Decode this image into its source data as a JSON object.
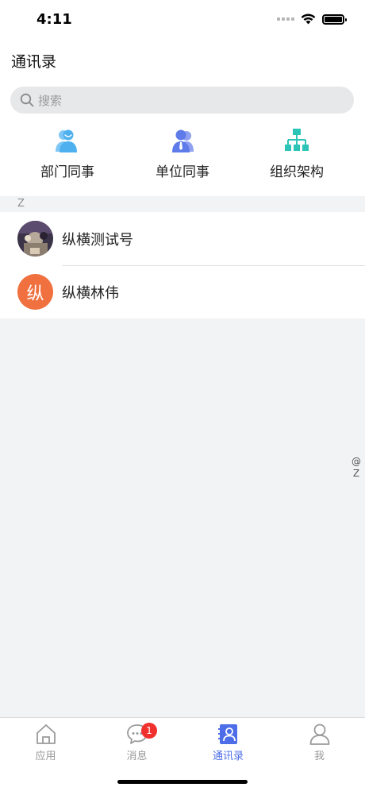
{
  "status_bar": {
    "time": "4:11"
  },
  "header": {
    "title": "通讯录"
  },
  "search": {
    "placeholder": "搜索"
  },
  "quick_actions": [
    {
      "label": "部门同事",
      "icon": "department-colleagues-icon",
      "color": "#4fb0ef"
    },
    {
      "label": "单位同事",
      "icon": "unit-colleagues-icon",
      "color": "#5f7be9"
    },
    {
      "label": "组织架构",
      "icon": "org-structure-icon",
      "color": "#2dc4b8"
    }
  ],
  "section": {
    "index_letter": "Z"
  },
  "contacts": [
    {
      "name": "纵横测试号",
      "avatar": "photo"
    },
    {
      "name": "纵横林伟",
      "avatar_text": "纵",
      "avatar_color": "#f0703f"
    }
  ],
  "side_index": [
    "@",
    "Z"
  ],
  "tab_bar": {
    "tabs": [
      {
        "label": "应用",
        "icon": "home-icon"
      },
      {
        "label": "消息",
        "icon": "message-icon",
        "badge": "1"
      },
      {
        "label": "通讯录",
        "icon": "contacts-icon",
        "active": true
      },
      {
        "label": "我",
        "icon": "user-icon"
      }
    ],
    "active_color": "#4d6ee8",
    "badge_color": "#f0302c"
  }
}
